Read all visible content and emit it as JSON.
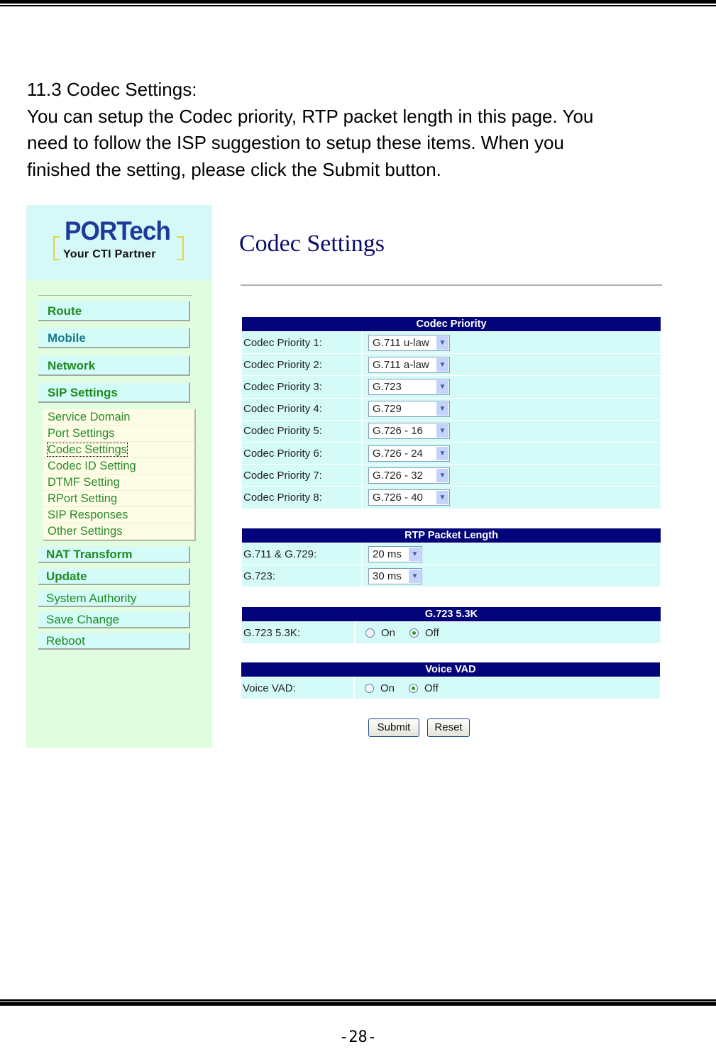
{
  "document": {
    "section_heading": "11.3 Codec Settings:",
    "paragraph_lines": [
      "You can setup the Codec priority, RTP packet length in this page. You",
      "need to follow the ISP suggestion to setup these items. When you",
      "finished the setting, please click the Submit button."
    ],
    "page_number": "-28-"
  },
  "screenshot": {
    "logo": {
      "brand": "PORTech",
      "tagline": "Your CTI Partner"
    },
    "sidebar": {
      "top_items": [
        "Route",
        "Mobile",
        "Network",
        "SIP Settings"
      ],
      "sip_submenu": [
        "Service Domain",
        "Port Settings",
        "Codec Settings",
        "Codec ID Setting",
        "DTMF Setting",
        "RPort Setting",
        "SIP Responses",
        "Other Settings"
      ],
      "active_submenu": "Codec Settings",
      "bottom_items": [
        "NAT Transform",
        "Update",
        "System Authority",
        "Save Change",
        "Reboot"
      ]
    },
    "main": {
      "title": "Codec Settings",
      "codec_priority": {
        "header": "Codec Priority",
        "rows": [
          {
            "label": "Codec Priority 1:",
            "value": "G.711 u-law"
          },
          {
            "label": "Codec Priority 2:",
            "value": "G.711 a-law"
          },
          {
            "label": "Codec Priority 3:",
            "value": "G.723"
          },
          {
            "label": "Codec Priority 4:",
            "value": "G.729"
          },
          {
            "label": "Codec Priority 5:",
            "value": "G.726 - 16"
          },
          {
            "label": "Codec Priority 6:",
            "value": "G.726 - 24"
          },
          {
            "label": "Codec Priority 7:",
            "value": "G.726 - 32"
          },
          {
            "label": "Codec Priority 8:",
            "value": "G.726 - 40"
          }
        ]
      },
      "rtp_packet_length": {
        "header": "RTP Packet Length",
        "rows": [
          {
            "label": "G.711 & G.729:",
            "value": "20 ms"
          },
          {
            "label": "G.723:",
            "value": "30 ms"
          }
        ]
      },
      "g723_53k": {
        "header": "G.723 5.3K",
        "label": "G.723 5.3K:",
        "options": [
          "On",
          "Off"
        ],
        "selected": "Off"
      },
      "voice_vad": {
        "header": "Voice VAD",
        "label": "Voice VAD:",
        "options": [
          "On",
          "Off"
        ],
        "selected": "Off"
      },
      "buttons": {
        "submit": "Submit",
        "reset": "Reset"
      }
    },
    "colors": {
      "section_header_bg": "#03037a",
      "row_bg": "#d5fbf8",
      "sidebar_bg": "#e0fde0",
      "nav_text": "#1f8a20",
      "title_color": "#0b0b6b"
    }
  }
}
